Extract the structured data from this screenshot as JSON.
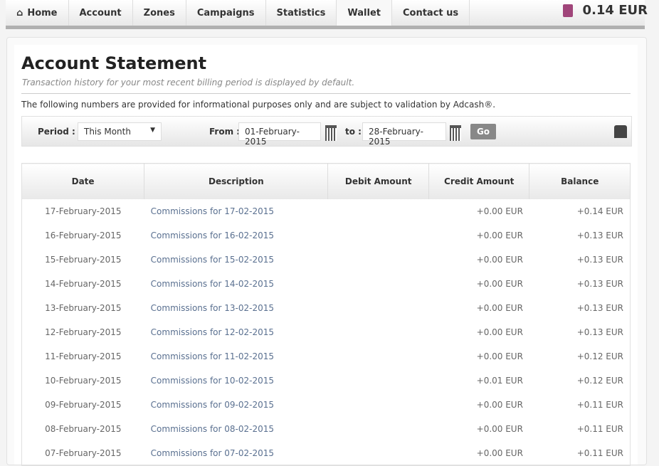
{
  "nav": {
    "items": [
      "Home",
      "Account",
      "Zones",
      "Campaigns",
      "Statistics",
      "Wallet",
      "Contact us"
    ],
    "active": "Wallet",
    "balance": "0.14 EUR"
  },
  "page": {
    "title": "Account Statement",
    "subtitle": "Transaction history for your most recent billing period is displayed by default.",
    "note": "The following numbers are provided for informational purposes only and are subject to validation by Adcash®."
  },
  "filter": {
    "period_label": "Period :",
    "period_value": "This Month",
    "from_label": "From :",
    "from_value": "01-February-2015",
    "to_label": "to :",
    "to_value": "28-February-2015",
    "go": "Go"
  },
  "table": {
    "headers": [
      "Date",
      "Description",
      "Debit Amount",
      "Credit Amount",
      "Balance"
    ],
    "rows": [
      [
        "17-February-2015",
        "Commissions for 17-02-2015",
        "",
        "+0.00 EUR",
        "+0.14 EUR"
      ],
      [
        "16-February-2015",
        "Commissions for 16-02-2015",
        "",
        "+0.00 EUR",
        "+0.13 EUR"
      ],
      [
        "15-February-2015",
        "Commissions for 15-02-2015",
        "",
        "+0.00 EUR",
        "+0.13 EUR"
      ],
      [
        "14-February-2015",
        "Commissions for 14-02-2015",
        "",
        "+0.00 EUR",
        "+0.13 EUR"
      ],
      [
        "13-February-2015",
        "Commissions for 13-02-2015",
        "",
        "+0.00 EUR",
        "+0.13 EUR"
      ],
      [
        "12-February-2015",
        "Commissions for 12-02-2015",
        "",
        "+0.00 EUR",
        "+0.13 EUR"
      ],
      [
        "11-February-2015",
        "Commissions for 11-02-2015",
        "",
        "+0.00 EUR",
        "+0.12 EUR"
      ],
      [
        "10-February-2015",
        "Commissions for 10-02-2015",
        "",
        "+0.01 EUR",
        "+0.12 EUR"
      ],
      [
        "09-February-2015",
        "Commissions for 09-02-2015",
        "",
        "+0.00 EUR",
        "+0.11 EUR"
      ],
      [
        "08-February-2015",
        "Commissions for 08-02-2015",
        "",
        "+0.00 EUR",
        "+0.11 EUR"
      ],
      [
        "07-February-2015",
        "Commissions for 07-02-2015",
        "",
        "+0.00 EUR",
        "+0.11 EUR"
      ]
    ]
  }
}
